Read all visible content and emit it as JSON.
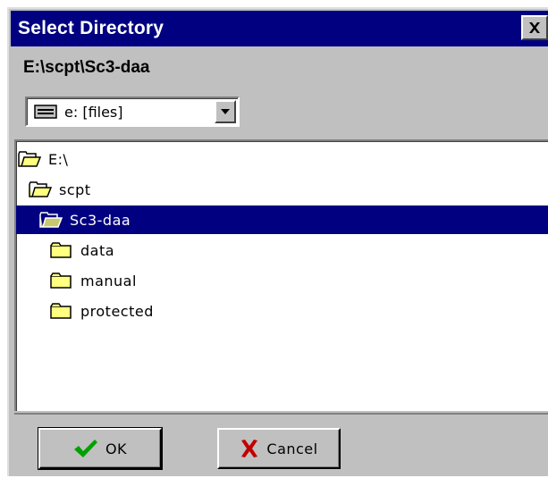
{
  "dialog": {
    "title": "Select Directory",
    "close_icon": "close-icon",
    "current_path": "E:\\scpt\\Sc3-daa"
  },
  "drive": {
    "selected": "e: [files]",
    "icon": "drive-icon"
  },
  "tree": {
    "items": [
      {
        "label": "E:\\",
        "icon": "open-folder-icon",
        "selected": false
      },
      {
        "label": "scpt",
        "icon": "open-folder-icon",
        "selected": false
      },
      {
        "label": "Sc3-daa",
        "icon": "open-folder-icon",
        "selected": true
      },
      {
        "label": "data",
        "icon": "folder-icon",
        "selected": false
      },
      {
        "label": "manual",
        "icon": "folder-icon",
        "selected": false
      },
      {
        "label": "protected",
        "icon": "folder-icon",
        "selected": false
      }
    ]
  },
  "buttons": {
    "ok_label": "OK",
    "cancel_label": "Cancel"
  },
  "colors": {
    "titlebar": "#000080",
    "face": "#c0c0c0",
    "selection": "#000080",
    "folder": "#ffff80",
    "ok_check": "#00a000",
    "cancel_x": "#c00000"
  }
}
